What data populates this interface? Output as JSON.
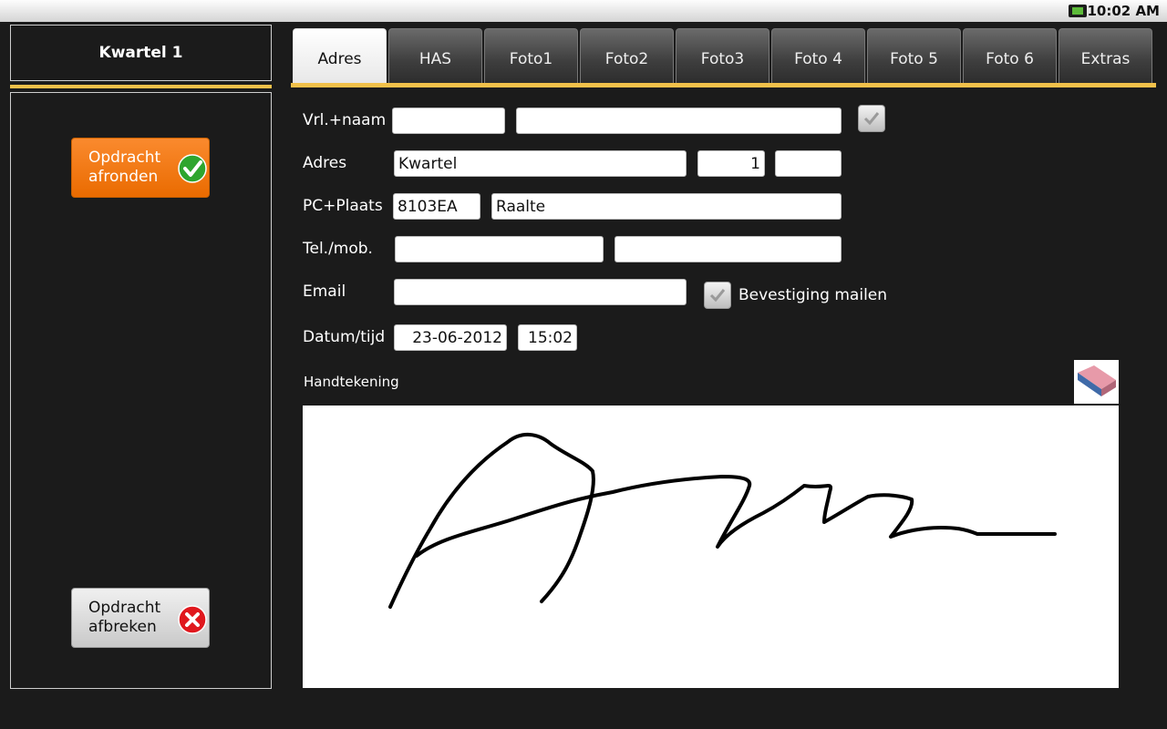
{
  "status_bar": {
    "time": "10:02 AM",
    "icon": "battery-icon"
  },
  "left_panel": {
    "title": "Kwartel 1",
    "finish_label": "Opdracht\nafronden",
    "abort_label": "Opdracht\nafbreken"
  },
  "tabs": [
    {
      "label": "Adres",
      "active": true
    },
    {
      "label": "HAS"
    },
    {
      "label": "Foto1"
    },
    {
      "label": "Foto2"
    },
    {
      "label": "Foto3"
    },
    {
      "label": "Foto 4"
    },
    {
      "label": "Foto 5"
    },
    {
      "label": "Foto 6"
    },
    {
      "label": "Extras"
    }
  ],
  "form": {
    "name_label": "Vrl.+naam",
    "initials_value": "",
    "name_value": "",
    "address_label": "Adres",
    "street_value": "Kwartel",
    "number_value": "1",
    "addition_value": "",
    "postal_label": "PC+Plaats",
    "postcode_value": "8103EA",
    "city_value": "Raalte",
    "phone_label": "Tel./mob.",
    "phone_value": "",
    "mobile_value": "",
    "email_label": "Email",
    "email_value": "",
    "confirm_mail_label": "Bevestiging mailen",
    "datetime_label": "Datum/tijd",
    "date_value": "23-06-2012",
    "time_value": "15:02"
  },
  "signature": {
    "label": "Handtekening"
  },
  "colors": {
    "accent": "#f2c14a",
    "finish_button": "#f07a17",
    "background": "#1b1b1b"
  }
}
